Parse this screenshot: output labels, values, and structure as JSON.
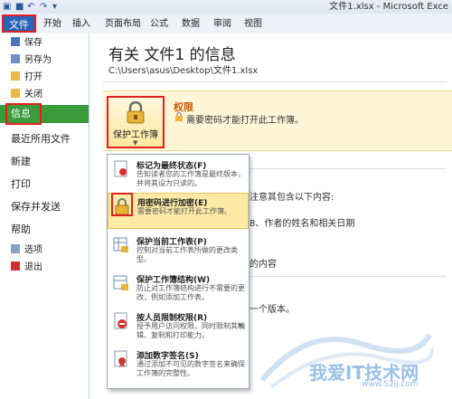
{
  "window": {
    "title": "文件1.xlsx - Microsoft Exce"
  },
  "ribbon": {
    "tabs": [
      "文件",
      "开始",
      "插入",
      "页面布局",
      "公式",
      "数据",
      "审阅",
      "视图"
    ]
  },
  "sidebar": {
    "small_items": [
      "保存",
      "另存为",
      "打开",
      "关闭"
    ],
    "big_items": [
      "信息",
      "最近所用文件",
      "新建",
      "打印",
      "保存并发送",
      "帮助"
    ],
    "bottom_items": [
      "选项",
      "退出"
    ]
  },
  "main": {
    "title": "有关 文件1 的信息",
    "path": "C:\\Users\\asus\\Desktop\\文件1.xlsx",
    "protect_button": "保护工作簿",
    "permissions": {
      "title": "权限",
      "desc": "需要密码才能打开此工作簿。"
    },
    "bg_fragments": {
      "line1": "注意其包含以下内容:",
      "line2": "8、作者的姓名和相关日期",
      "line3": "的内容",
      "line4": "一个版本。"
    }
  },
  "menu": {
    "items": [
      {
        "title": "标记为最终状态(F)",
        "desc": "告知读者您的工作簿是最终版本，并将其设为只读的。",
        "icon": "mark-final-icon"
      },
      {
        "title": "用密码进行加密(E)",
        "desc": "需要密码才能打开此工作簿。",
        "icon": "lock-icon"
      },
      {
        "title": "保护当前工作表(P)",
        "desc": "控制对当前工作表所做的更改类型。",
        "icon": "protect-sheet-icon"
      },
      {
        "title": "保护工作簿结构(W)",
        "desc": "防止对工作簿结构进行不需要的更改，例如添加工作表。",
        "icon": "protect-structure-icon"
      },
      {
        "title": "按人员限制权限(R)",
        "desc": "授予用户访问权限，同时限制其编辑、复制和打印能力。",
        "icon": "restrict-permission-icon"
      },
      {
        "title": "添加数字签名(S)",
        "desc": "通过添加不可见的数字签名来确保工作簿的完整性。",
        "icon": "digital-signature-icon"
      }
    ]
  },
  "watermark": {
    "text": "我爱IT技术网",
    "url": "www.52ij.com"
  },
  "colors": {
    "file_tab": "#2a63b8",
    "info_selected": "#3b9b3b",
    "highlight": "#e02020",
    "perm_band": "#fff6d8"
  }
}
